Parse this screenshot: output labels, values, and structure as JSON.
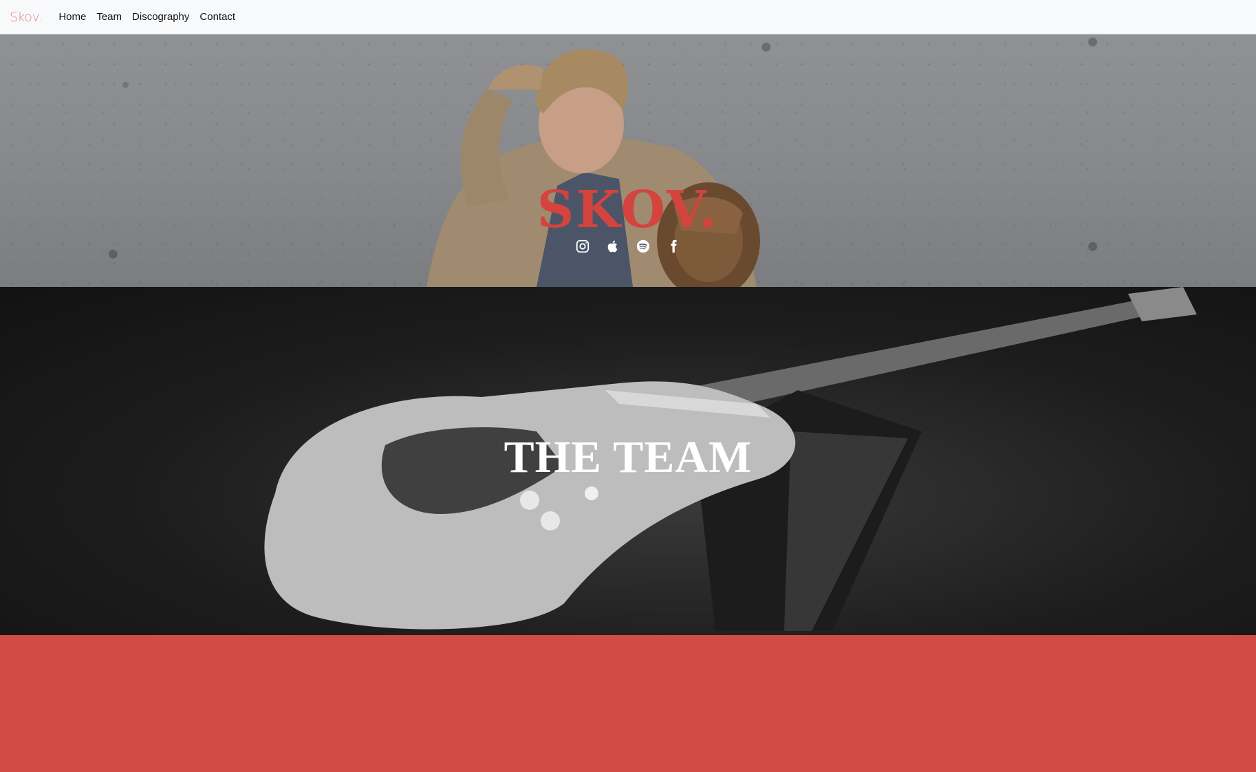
{
  "nav": {
    "brand": "Skov.",
    "links": [
      {
        "label": "Home"
      },
      {
        "label": "Team"
      },
      {
        "label": "Discography"
      },
      {
        "label": "Contact"
      }
    ]
  },
  "hero": {
    "title": "SKOV.",
    "social": [
      {
        "icon": "instagram-icon"
      },
      {
        "icon": "apple-icon"
      },
      {
        "icon": "spotify-icon"
      },
      {
        "icon": "facebook-icon"
      }
    ]
  },
  "team": {
    "title": "THE TEAM"
  },
  "colors": {
    "accent": "#d24b45",
    "brand": "#e4888a",
    "navbar_bg": "#f8f9fb"
  }
}
